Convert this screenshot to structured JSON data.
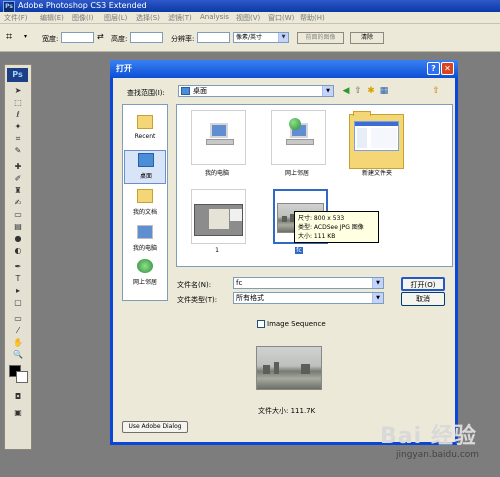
{
  "app": {
    "title": "Adobe Photoshop CS3 Extended",
    "logo": "Ps"
  },
  "menubar": [
    "文件(F)",
    "编辑(E)",
    "图像(I)",
    "图层(L)",
    "选择(S)",
    "滤镜(T)",
    "Analysis",
    "视图(V)",
    "窗口(W)",
    "帮助(H)"
  ],
  "options_bar": {
    "width_label": "宽度:",
    "height_label": "高度:",
    "resolution_label": "分辨率:",
    "unit_value": "像素/英寸",
    "front_image_button": "前面的图像",
    "clear_button": "清除"
  },
  "toolbox": {
    "logo": "Ps",
    "tools": [
      "move-tool-icon",
      "marquee-tool-icon",
      "lasso-tool-icon",
      "magic-wand-icon",
      "crop-tool-icon",
      "slice-tool-icon",
      "healing-brush-icon",
      "brush-tool-icon",
      "clone-stamp-icon",
      "history-brush-icon",
      "eraser-icon",
      "gradient-tool-icon",
      "blur-tool-icon",
      "dodge-tool-icon",
      "pen-tool-icon",
      "type-tool-icon",
      "path-select-icon",
      "shape-tool-icon",
      "notes-tool-icon",
      "eyedropper-icon",
      "hand-tool-icon",
      "zoom-tool-icon"
    ]
  },
  "dialog": {
    "title": "打开",
    "help_label": "?",
    "close_label": "✕",
    "look_in_label": "查找范围(I):",
    "look_in_value": "桌面",
    "places": [
      {
        "label": "Recent",
        "icon": "recent-folder-icon"
      },
      {
        "label": "桌面",
        "icon": "desktop-icon"
      },
      {
        "label": "我的文档",
        "icon": "my-documents-icon"
      },
      {
        "label": "我的电脑",
        "icon": "my-computer-icon"
      },
      {
        "label": "网上邻居",
        "icon": "network-places-icon"
      }
    ],
    "files": [
      {
        "label": "我的电脑"
      },
      {
        "label": "网上邻居"
      },
      {
        "label": "新建文件夹"
      },
      {
        "label": "1"
      },
      {
        "label": "fc"
      }
    ],
    "tooltip": {
      "size": "尺寸: 800 x 533",
      "type": "类型: ACDSee JPG 图像",
      "filesize": "大小: 111 KB"
    },
    "filename_label": "文件名(N):",
    "filename_value": "fc",
    "filetype_label": "文件类型(T):",
    "filetype_value": "所有格式",
    "open_button": "打开(O)",
    "cancel_button": "取消",
    "image_sequence_label": "Image Sequence",
    "file_size_text": "文件大小: 111.7K",
    "adobe_dialog_button": "Use Adobe Dialog"
  },
  "watermark": {
    "text": "Bai 经验",
    "url": "jingyan.baidu.com"
  }
}
